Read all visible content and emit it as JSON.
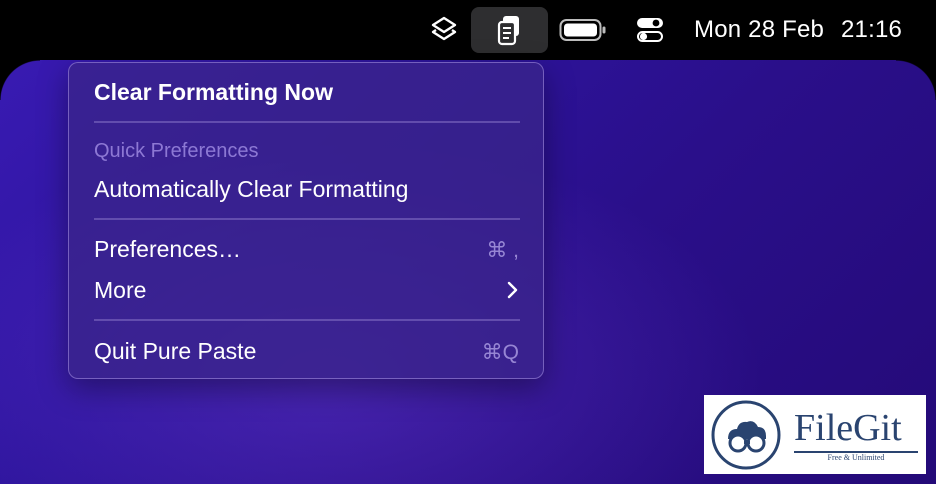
{
  "menubar": {
    "date": "Mon 28 Feb",
    "time": "21:16",
    "icons": [
      "layers-icon",
      "pure-paste-icon",
      "battery-icon",
      "control-center-icon"
    ]
  },
  "menu": {
    "clear_now": "Clear Formatting Now",
    "section_header": "Quick Preferences",
    "auto_clear": "Automatically Clear Formatting",
    "preferences": "Preferences…",
    "preferences_shortcut": "⌘ ,",
    "more": "More",
    "quit": "Quit Pure Paste",
    "quit_shortcut": "⌘Q"
  },
  "watermark": {
    "brand": "FileGit",
    "tagline": "Free & Unlimited"
  }
}
